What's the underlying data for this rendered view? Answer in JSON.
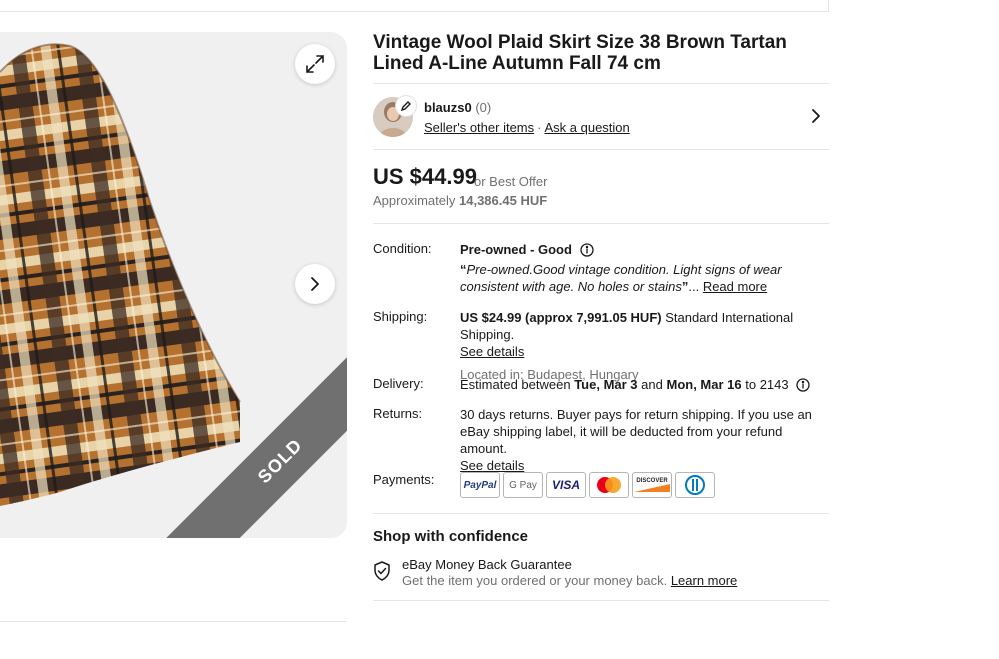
{
  "listing": {
    "title": "Vintage Wool Plaid Skirt Size 38 Brown Tartan Lined A-Line Autumn Fall 74 cm",
    "sold_badge": "SOLD"
  },
  "seller": {
    "name": "blauzs0",
    "feedback": "(0)",
    "other_items_link": "Seller's other items",
    "separator": "·",
    "ask_link": "Ask a question"
  },
  "price": {
    "main": "US $44.99",
    "offer": "or Best Offer",
    "approx_prefix": "Approximately",
    "approx_value": "14,386.45 HUF"
  },
  "condition": {
    "label": "Condition:",
    "value": "Pre-owned - Good",
    "open_quote": "“",
    "quote": "Pre-owned.Good vintage condition. Light signs of wear consistent with age. No holes or stains",
    "close_quote": "”",
    "ellipsis": "...",
    "read_more": "Read more"
  },
  "shipping": {
    "label": "Shipping:",
    "cost": "US $24.99 (approx 7,991.05 HUF)",
    "method": "Standard International Shipping.",
    "see_details": "See details",
    "location": "Located in: Budapest, Hungary"
  },
  "delivery": {
    "label": "Delivery:",
    "prefix": "Estimated between",
    "start": "Tue, Mar 3",
    "and": "and",
    "end": "Mon, Mar 16",
    "to": "to 2143"
  },
  "returns": {
    "label": "Returns:",
    "text": "30 days returns. Buyer pays for return shipping. If you use an eBay shipping label, it will be deducted from your refund amount.",
    "see_details": "See details"
  },
  "payments": {
    "label": "Payments:",
    "methods": [
      "PayPal",
      "G Pay",
      "VISA",
      "Mastercard",
      "DISCOVER",
      "Diners Club"
    ]
  },
  "confidence": {
    "title": "Shop with confidence",
    "guarantee": "eBay Money Back Guarantee",
    "description": "Get the item you ordered or your money back.",
    "learn_more": "Learn more"
  },
  "colors": {
    "text": "#191919",
    "muted": "#707070",
    "divider": "#e5e5e5",
    "sold_band": "#707070",
    "gallery_bg": "#f0f0f0"
  },
  "icons": [
    "expand-icon",
    "chevron-right-icon",
    "edit-pencil-icon",
    "info-icon",
    "shield-check-icon"
  ]
}
